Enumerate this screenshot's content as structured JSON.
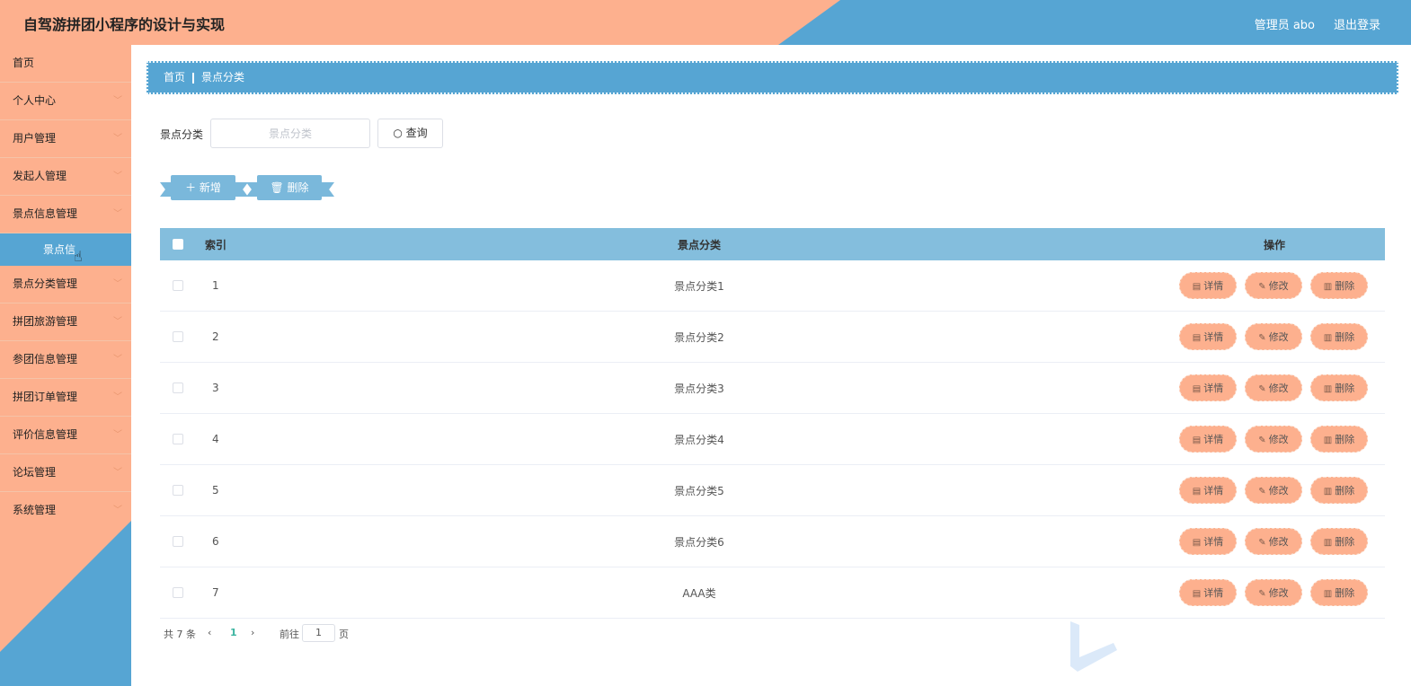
{
  "header": {
    "title": "自驾游拼团小程序的设计与实现",
    "admin": "管理员 abo",
    "logout": "退出登录"
  },
  "sidebar": {
    "items": [
      {
        "label": "首页"
      },
      {
        "label": "个人中心"
      },
      {
        "label": "用户管理"
      },
      {
        "label": "发起人管理"
      },
      {
        "label": "景点信息管理"
      },
      {
        "label": "景点分类管理"
      },
      {
        "label": "拼团旅游管理"
      },
      {
        "label": "参团信息管理"
      },
      {
        "label": "拼团订单管理"
      },
      {
        "label": "评价信息管理"
      },
      {
        "label": "论坛管理"
      },
      {
        "label": "系统管理"
      }
    ],
    "submenu_label": "景点信"
  },
  "breadcrumb": {
    "home": "首页",
    "current": "景点分类"
  },
  "search": {
    "label": "景点分类",
    "placeholder": "景点分类",
    "button": "查询"
  },
  "actions": {
    "add": "新增",
    "delete": "删除"
  },
  "table": {
    "headers": {
      "index": "索引",
      "category": "景点分类",
      "ops": "操作"
    },
    "rows": [
      {
        "index": "1",
        "category": "景点分类1"
      },
      {
        "index": "2",
        "category": "景点分类2"
      },
      {
        "index": "3",
        "category": "景点分类3"
      },
      {
        "index": "4",
        "category": "景点分类4"
      },
      {
        "index": "5",
        "category": "景点分类5"
      },
      {
        "index": "6",
        "category": "景点分类6"
      },
      {
        "index": "7",
        "category": "AAA类"
      }
    ],
    "row_actions": {
      "detail": "详情",
      "edit": "修改",
      "delete": "删除"
    }
  },
  "pagination": {
    "total": "共 7 条",
    "current": "1",
    "goto": "前往",
    "page_input": "1",
    "page_unit": "页"
  }
}
